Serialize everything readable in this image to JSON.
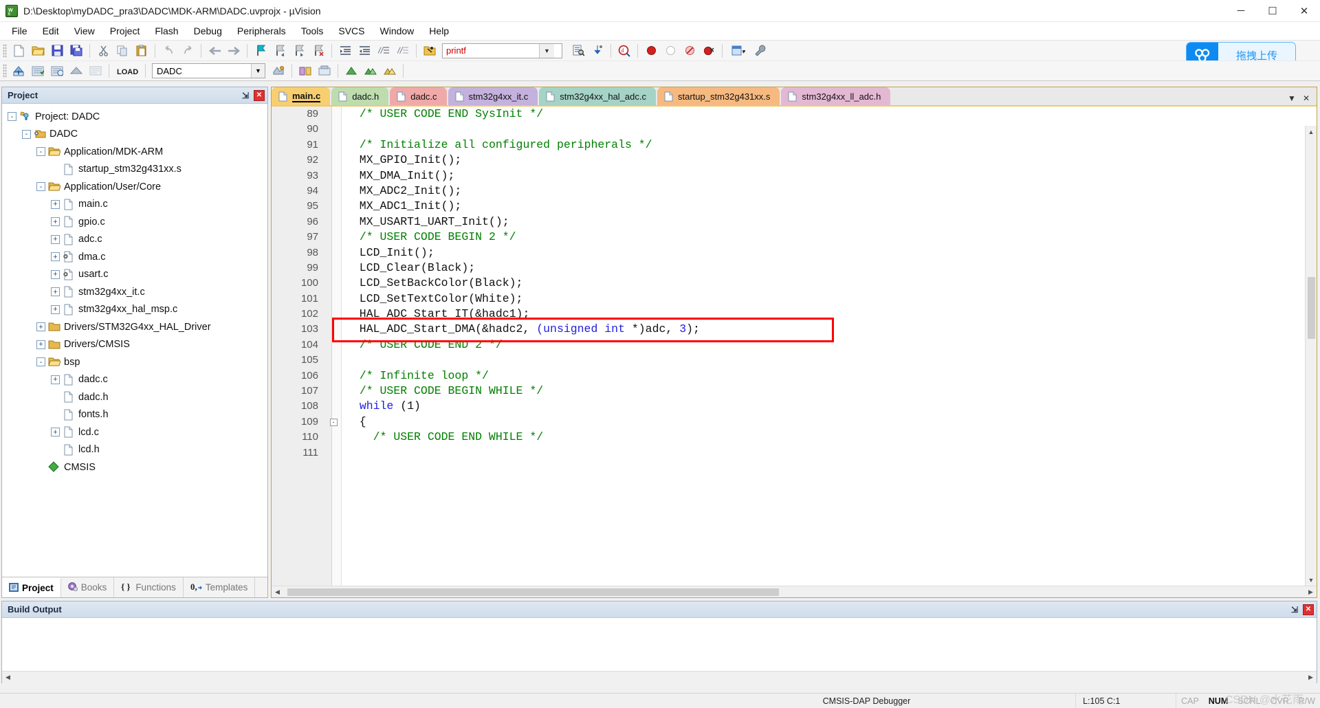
{
  "window": {
    "title": "D:\\Desktop\\myDADC_pra3\\DADC\\MDK-ARM\\DADC.uvprojx - µVision",
    "app_icon": "uvision-icon",
    "minimize": "─",
    "maximize": "☐",
    "close": "✕"
  },
  "menu": {
    "items": [
      "File",
      "Edit",
      "View",
      "Project",
      "Flash",
      "Debug",
      "Peripherals",
      "Tools",
      "SVCS",
      "Window",
      "Help"
    ]
  },
  "toolbar": {
    "find_value": "printf",
    "find_placeholder": "",
    "target_value": "DADC",
    "dropdown_arrow": "▼"
  },
  "upload_widget": {
    "label": "拖拽上传",
    "icon": "cloud-upload-icon",
    "accent": "#0d8bf2"
  },
  "project_panel": {
    "title": "Project",
    "pin": "⇲",
    "close": "✕",
    "tree": [
      {
        "label": "Project: DADC",
        "indent": 0,
        "exp": "-",
        "icon": "project-icon"
      },
      {
        "label": "DADC",
        "indent": 1,
        "exp": "-",
        "icon": "target-icon"
      },
      {
        "label": "Application/MDK-ARM",
        "indent": 2,
        "exp": "-",
        "icon": "folder-open-icon"
      },
      {
        "label": "startup_stm32g431xx.s",
        "indent": 3,
        "exp": "",
        "icon": "file-icon"
      },
      {
        "label": "Application/User/Core",
        "indent": 2,
        "exp": "-",
        "icon": "folder-open-icon"
      },
      {
        "label": "main.c",
        "indent": 3,
        "exp": "+",
        "icon": "file-icon"
      },
      {
        "label": "gpio.c",
        "indent": 3,
        "exp": "+",
        "icon": "file-icon"
      },
      {
        "label": "adc.c",
        "indent": 3,
        "exp": "+",
        "icon": "file-icon"
      },
      {
        "label": "dma.c",
        "indent": 3,
        "exp": "+",
        "icon": "file-gear-icon"
      },
      {
        "label": "usart.c",
        "indent": 3,
        "exp": "+",
        "icon": "file-gear-icon"
      },
      {
        "label": "stm32g4xx_it.c",
        "indent": 3,
        "exp": "+",
        "icon": "file-icon"
      },
      {
        "label": "stm32g4xx_hal_msp.c",
        "indent": 3,
        "exp": "+",
        "icon": "file-icon"
      },
      {
        "label": "Drivers/STM32G4xx_HAL_Driver",
        "indent": 2,
        "exp": "+",
        "icon": "folder-icon"
      },
      {
        "label": "Drivers/CMSIS",
        "indent": 2,
        "exp": "+",
        "icon": "folder-icon"
      },
      {
        "label": "bsp",
        "indent": 2,
        "exp": "-",
        "icon": "folder-open-icon"
      },
      {
        "label": "dadc.c",
        "indent": 3,
        "exp": "+",
        "icon": "file-icon"
      },
      {
        "label": "dadc.h",
        "indent": 3,
        "exp": "",
        "icon": "file-icon"
      },
      {
        "label": "fonts.h",
        "indent": 3,
        "exp": "",
        "icon": "file-icon"
      },
      {
        "label": "lcd.c",
        "indent": 3,
        "exp": "+",
        "icon": "file-icon"
      },
      {
        "label": "lcd.h",
        "indent": 3,
        "exp": "",
        "icon": "file-icon"
      },
      {
        "label": "CMSIS",
        "indent": 2,
        "exp": "",
        "icon": "cmsis-icon"
      }
    ],
    "tabs": [
      {
        "label": "Project",
        "icon": "project-tab-icon",
        "active": true
      },
      {
        "label": "Books",
        "icon": "books-tab-icon",
        "active": false
      },
      {
        "label": "Functions",
        "icon": "functions-tab-icon",
        "active": false
      },
      {
        "label": "Templates",
        "icon": "templates-tab-icon",
        "active": false
      }
    ]
  },
  "editor": {
    "tabs": [
      {
        "label": "main.c",
        "color": "#f7cf71",
        "active": true
      },
      {
        "label": "dadc.h",
        "color": "#bedcae",
        "active": false
      },
      {
        "label": "dadc.c",
        "color": "#f0a9a9",
        "active": false
      },
      {
        "label": "stm32g4xx_it.c",
        "color": "#c4b1dd",
        "active": false
      },
      {
        "label": "stm32g4xx_hal_adc.c",
        "color": "#a5d3c6",
        "active": false
      },
      {
        "label": "startup_stm32g431xx.s",
        "color": "#f6b980",
        "active": false
      },
      {
        "label": "stm32g4xx_ll_adc.h",
        "color": "#e3b8d2",
        "active": false
      }
    ],
    "tab_prev": "▼",
    "tab_close": "✕",
    "code": [
      {
        "num": "89",
        "fold": "",
        "parts": [
          {
            "t": "  ",
            "c": "pln"
          },
          {
            "t": "/* USER CODE END SysInit */",
            "c": "cmt"
          }
        ]
      },
      {
        "num": "90",
        "fold": "",
        "parts": [
          {
            "t": "",
            "c": "pln"
          }
        ]
      },
      {
        "num": "91",
        "fold": "",
        "parts": [
          {
            "t": "  ",
            "c": "pln"
          },
          {
            "t": "/* Initialize all configured peripherals */",
            "c": "cmt"
          }
        ]
      },
      {
        "num": "92",
        "fold": "",
        "parts": [
          {
            "t": "  MX_GPIO_Init();",
            "c": "pln"
          }
        ]
      },
      {
        "num": "93",
        "fold": "",
        "parts": [
          {
            "t": "  MX_DMA_Init();",
            "c": "pln"
          }
        ]
      },
      {
        "num": "94",
        "fold": "",
        "parts": [
          {
            "t": "  MX_ADC2_Init();",
            "c": "pln"
          }
        ]
      },
      {
        "num": "95",
        "fold": "",
        "parts": [
          {
            "t": "  MX_ADC1_Init();",
            "c": "pln"
          }
        ]
      },
      {
        "num": "96",
        "fold": "",
        "parts": [
          {
            "t": "  MX_USART1_UART_Init();",
            "c": "pln"
          }
        ]
      },
      {
        "num": "97",
        "fold": "",
        "parts": [
          {
            "t": "  ",
            "c": "pln"
          },
          {
            "t": "/* USER CODE BEGIN 2 */",
            "c": "cmt"
          }
        ]
      },
      {
        "num": "98",
        "fold": "",
        "parts": [
          {
            "t": "  LCD_Init();",
            "c": "pln"
          }
        ]
      },
      {
        "num": "99",
        "fold": "",
        "parts": [
          {
            "t": "  LCD_Clear(Black);",
            "c": "pln"
          }
        ]
      },
      {
        "num": "100",
        "fold": "",
        "parts": [
          {
            "t": "  LCD_SetBackColor(Black);",
            "c": "pln"
          }
        ]
      },
      {
        "num": "101",
        "fold": "",
        "parts": [
          {
            "t": "  LCD_SetTextColor(White);",
            "c": "pln"
          }
        ]
      },
      {
        "num": "102",
        "fold": "",
        "parts": [
          {
            "t": "  HAL_ADC_Start_IT(&hadc1);",
            "c": "pln"
          }
        ]
      },
      {
        "num": "103",
        "fold": "",
        "parts": [
          {
            "t": "  HAL_ADC_Start_DMA(&hadc2, ",
            "c": "pln"
          },
          {
            "t": "(unsigned int ",
            "c": "kw"
          },
          {
            "t": "*)adc, ",
            "c": "pln"
          },
          {
            "t": "3",
            "c": "kw"
          },
          {
            "t": ");",
            "c": "pln"
          }
        ]
      },
      {
        "num": "104",
        "fold": "",
        "parts": [
          {
            "t": "  ",
            "c": "pln"
          },
          {
            "t": "/* USER CODE END 2 */",
            "c": "cmt"
          }
        ]
      },
      {
        "num": "105",
        "fold": "",
        "parts": [
          {
            "t": "",
            "c": "pln"
          }
        ]
      },
      {
        "num": "106",
        "fold": "",
        "parts": [
          {
            "t": "  ",
            "c": "pln"
          },
          {
            "t": "/* Infinite loop */",
            "c": "cmt"
          }
        ]
      },
      {
        "num": "107",
        "fold": "",
        "parts": [
          {
            "t": "  ",
            "c": "pln"
          },
          {
            "t": "/* USER CODE BEGIN WHILE */",
            "c": "cmt"
          }
        ]
      },
      {
        "num": "108",
        "fold": "",
        "parts": [
          {
            "t": "  ",
            "c": "pln"
          },
          {
            "t": "while",
            "c": "kw"
          },
          {
            "t": " (1)",
            "c": "pln"
          }
        ]
      },
      {
        "num": "109",
        "fold": "-",
        "parts": [
          {
            "t": "  {",
            "c": "pln"
          }
        ]
      },
      {
        "num": "110",
        "fold": "",
        "parts": [
          {
            "t": "    ",
            "c": "pln"
          },
          {
            "t": "/* USER CODE END WHILE */",
            "c": "cmt"
          }
        ]
      },
      {
        "num": "111",
        "fold": "",
        "parts": [
          {
            "t": "",
            "c": "pln"
          }
        ]
      }
    ],
    "highlight": {
      "line": "103",
      "color": "#ff0000"
    }
  },
  "build_panel": {
    "title": "Build Output",
    "pin": "⇲",
    "close": "✕",
    "content": ""
  },
  "statusbar": {
    "debugger": "CMSIS-DAP Debugger",
    "position": "L:105 C:1",
    "flags": [
      {
        "label": "CAP",
        "on": false
      },
      {
        "label": "NUM",
        "on": true
      },
      {
        "label": "SCRL",
        "on": false
      },
      {
        "label": "OVR",
        "on": false
      },
      {
        "label": "R/W",
        "on": false
      }
    ]
  },
  "watermark": "CSDN @水花雨"
}
